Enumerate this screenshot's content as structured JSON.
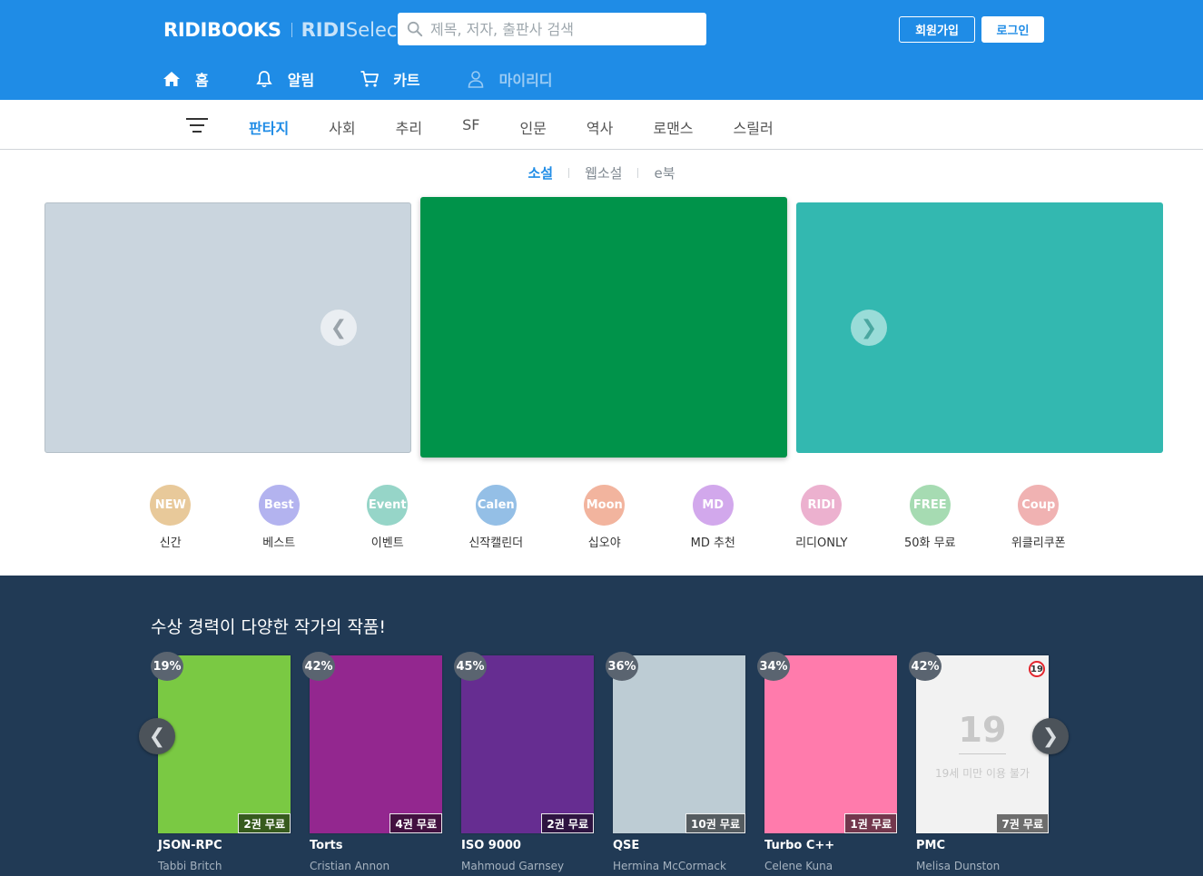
{
  "header": {
    "logo_main": "RIDIBOOKS",
    "logo_sub_bold": "RIDI",
    "logo_sub_rest": "Select",
    "search_placeholder": "제목, 저자, 출판사 검색",
    "join_label": "회원가입",
    "login_label": "로그인",
    "nav": [
      {
        "label": "홈",
        "icon": "home-icon"
      },
      {
        "label": "알림",
        "icon": "bell-icon"
      },
      {
        "label": "카트",
        "icon": "cart-icon"
      },
      {
        "label": "마이리디",
        "icon": "user-icon"
      }
    ]
  },
  "genre_tabs": [
    {
      "label": "판타지",
      "active": true
    },
    {
      "label": "사회"
    },
    {
      "label": "추리"
    },
    {
      "label": "SF"
    },
    {
      "label": "인문"
    },
    {
      "label": "역사"
    },
    {
      "label": "로맨스"
    },
    {
      "label": "스릴러"
    }
  ],
  "sub_tabs": [
    {
      "label": "소설",
      "active": true
    },
    {
      "label": "웹소설"
    },
    {
      "label": "e북"
    }
  ],
  "banners": [
    {
      "color": "#cad5de"
    },
    {
      "color": "#00934a"
    },
    {
      "color": "#33b8b0"
    }
  ],
  "arrows": {
    "prev": "❮",
    "next": "❯"
  },
  "quick_menu": [
    {
      "icon_text": "NEW",
      "label": "신간",
      "color": "#e8c99a"
    },
    {
      "icon_text": "Best",
      "label": "베스트",
      "color": "#b3b3ef"
    },
    {
      "icon_text": "Event",
      "label": "이벤트",
      "color": "#96d5c8"
    },
    {
      "icon_text": "Calen",
      "label": "신작캘린더",
      "color": "#94bfe6"
    },
    {
      "icon_text": "Moon",
      "label": "십오야",
      "color": "#f2b49e"
    },
    {
      "icon_text": "MD",
      "label": "MD 추천",
      "color": "#d2a8ec"
    },
    {
      "icon_text": "RIDI",
      "label": "리디ONLY",
      "color": "#ecb1cf"
    },
    {
      "icon_text": "FREE",
      "label": "50화 무료",
      "color": "#a6dbb2"
    },
    {
      "icon_text": "Coup",
      "label": "위클리쿠폰",
      "color": "#f0b2b2"
    }
  ],
  "section": {
    "title": "수상 경력이 다양한 작가의 작품!",
    "books": [
      {
        "discount": "19%",
        "free": "2권 무료",
        "title": "JSON-RPC",
        "author": "Tabbi Britch",
        "color": "#7ac943"
      },
      {
        "discount": "42%",
        "free": "4권 무료",
        "title": "Torts",
        "author": "Cristian Annon",
        "color": "#93278f"
      },
      {
        "discount": "45%",
        "free": "2권 무료",
        "title": "ISO 9000",
        "author": "Mahmoud Garnsey",
        "color": "#662d91"
      },
      {
        "discount": "36%",
        "free": "10권 무료",
        "title": "QSE",
        "author": "Hermina McCormack",
        "color": "#bdccd4"
      },
      {
        "discount": "34%",
        "free": "1권 무료",
        "title": "Turbo C++",
        "author": "Celene Kuna",
        "color": "#ff7bac"
      },
      {
        "discount": "42%",
        "free": "7권 무료",
        "title": "PMC",
        "author": "Melisa Dunston",
        "color": "#f2f2f2",
        "adult": true,
        "adult_num": "19",
        "adult_text": "19세 미만 이용 불가",
        "adult_mark": "19"
      }
    ]
  }
}
